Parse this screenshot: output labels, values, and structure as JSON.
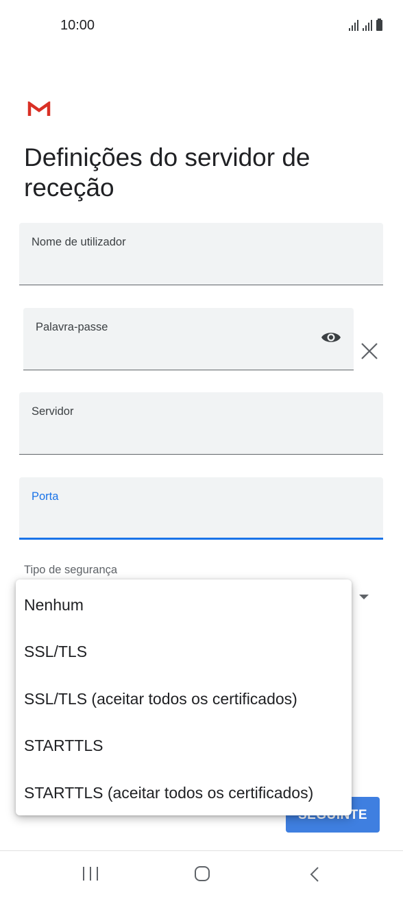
{
  "status_bar": {
    "time": "10:00",
    "icons": [
      "signal-icon",
      "signal-icon",
      "battery-icon"
    ]
  },
  "app": {
    "logo_icon": "gmail-logo-icon",
    "logo_color": "#d93025"
  },
  "title": "Definições do servidor de receção",
  "fields": {
    "username": {
      "label": "Nome de utilizador",
      "value": ""
    },
    "password": {
      "label": "Palavra-passe",
      "value": "",
      "show_icon": "eye-icon",
      "clear_icon": "close-icon"
    },
    "server": {
      "label": "Servidor",
      "value": ""
    },
    "port": {
      "label": "Porta",
      "value": "",
      "focused": true
    }
  },
  "security": {
    "label": "Tipo de segurança",
    "options": [
      "Nenhum",
      "SSL/TLS",
      "SSL/TLS (aceitar todos os certificados)",
      "STARTTLS",
      "STARTTLS (aceitar todos os certificados)"
    ]
  },
  "next_button": {
    "label": "SEGUINTE",
    "color": "#3f7fe0"
  },
  "accent_color": "#1a73e8",
  "nav_bar": {
    "icons": [
      "recents-icon",
      "home-icon",
      "back-icon"
    ]
  }
}
